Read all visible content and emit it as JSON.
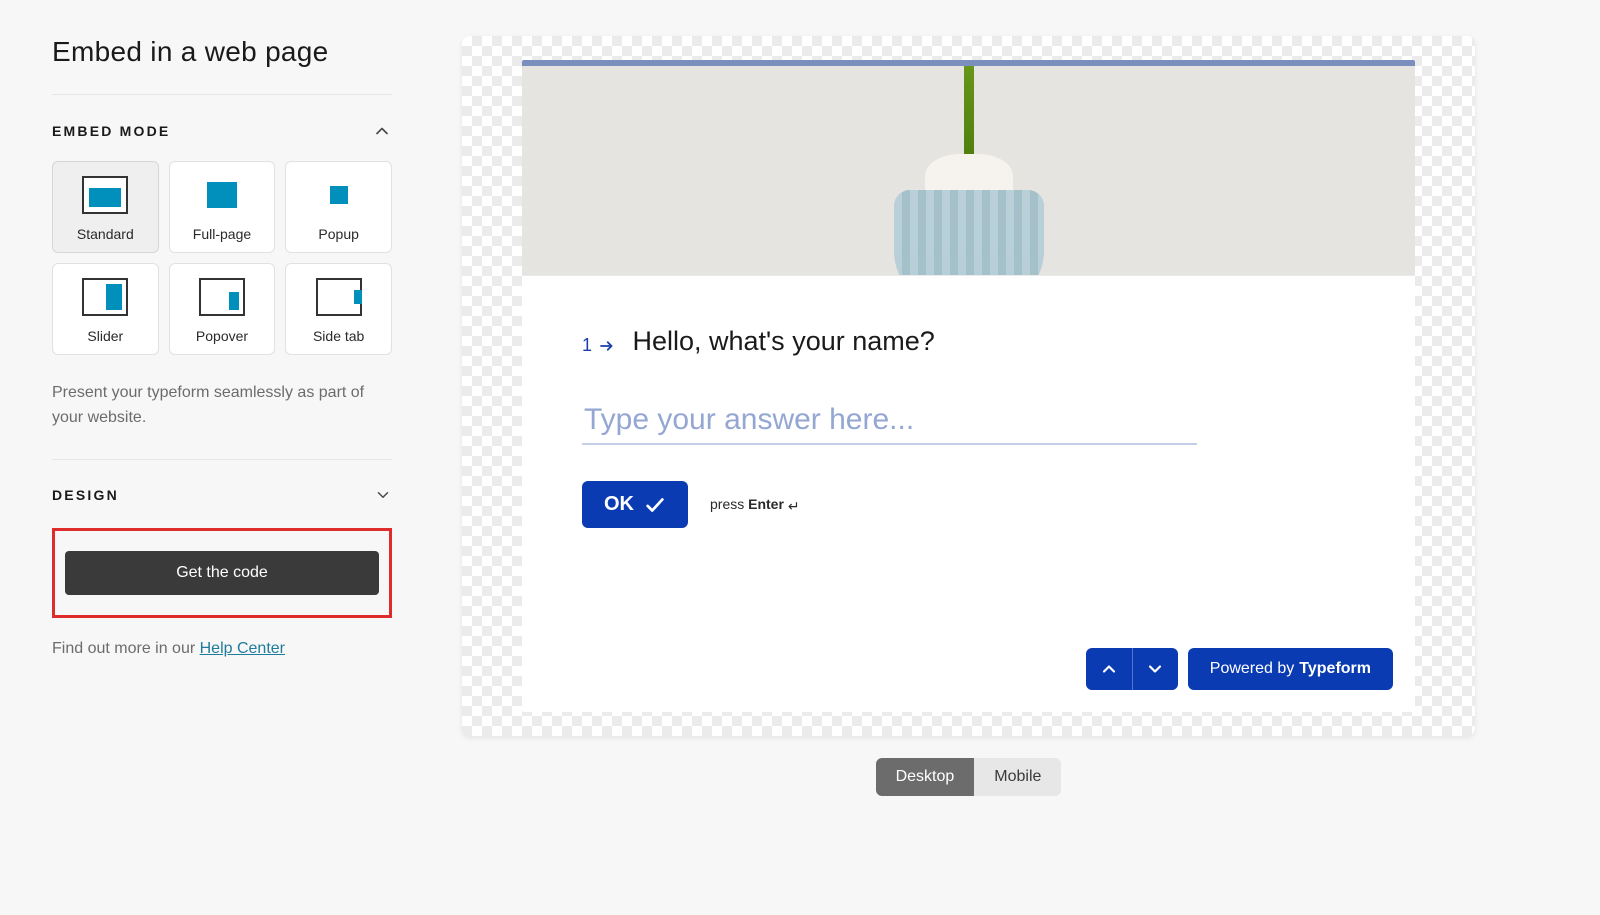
{
  "sidebar": {
    "title": "Embed in a web page",
    "embed_mode": {
      "label": "Embed mode",
      "tiles": [
        {
          "label": "Standard",
          "name": "mode-standard",
          "selected": true
        },
        {
          "label": "Full-page",
          "name": "mode-fullpage",
          "selected": false
        },
        {
          "label": "Popup",
          "name": "mode-popup",
          "selected": false
        },
        {
          "label": "Slider",
          "name": "mode-slider",
          "selected": false
        },
        {
          "label": "Popover",
          "name": "mode-popover",
          "selected": false
        },
        {
          "label": "Side tab",
          "name": "mode-sidetab",
          "selected": false
        }
      ],
      "description": "Present your typeform seamlessly as part of your website."
    },
    "design": {
      "label": "Design"
    },
    "cta_label": "Get the code",
    "help_prefix": "Find out more in our ",
    "help_link_label": "Help Center"
  },
  "form": {
    "question_number": "1",
    "question_text": "Hello, what's your name?",
    "answer_placeholder": "Type your answer here...",
    "ok_label": "OK",
    "press_prefix": "press ",
    "press_key": "Enter",
    "powered_prefix": "Powered by ",
    "powered_brand": "Typeform"
  },
  "device_toggle": {
    "desktop": "Desktop",
    "mobile": "Mobile"
  }
}
